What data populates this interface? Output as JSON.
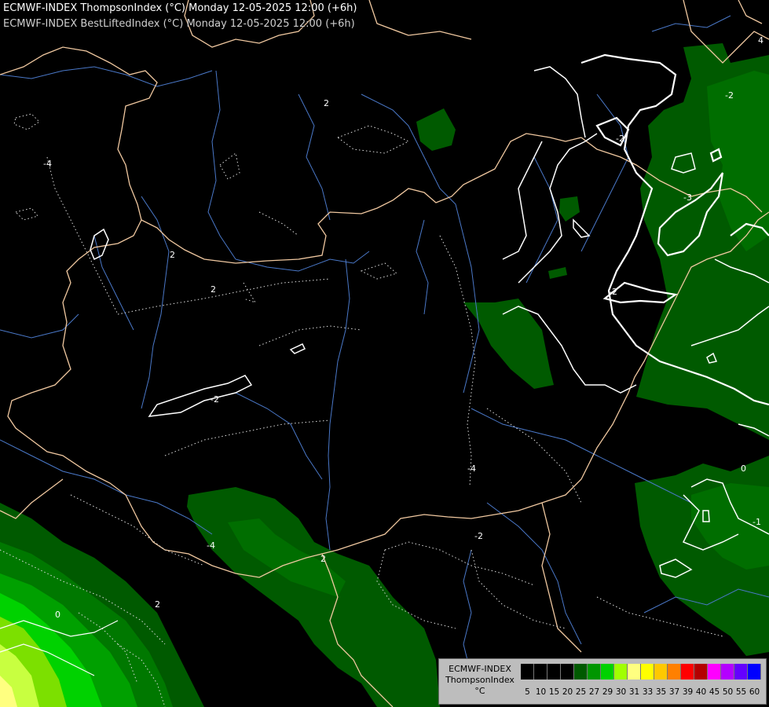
{
  "header": {
    "line1": "ECMWF-INDEX ThompsonIndex (°C) Monday 12-05-2025 12:00 (+6h)",
    "line2": "ECMWF-INDEX BestLiftedIndex (°C) Monday 12-05-2025 12:00 (+6h)"
  },
  "legend": {
    "line1": "ECMWF-INDEX",
    "line2": "ThompsonIndex",
    "line3": "°C",
    "bins": [
      {
        "label": "5",
        "color": "#000000"
      },
      {
        "label": "10",
        "color": "#000000"
      },
      {
        "label": "15",
        "color": "#000000"
      },
      {
        "label": "20",
        "color": "#000000"
      },
      {
        "label": "25",
        "color": "#005a00"
      },
      {
        "label": "27",
        "color": "#009600"
      },
      {
        "label": "29",
        "color": "#00d200"
      },
      {
        "label": "30",
        "color": "#a0ff00"
      },
      {
        "label": "31",
        "color": "#ffff80"
      },
      {
        "label": "33",
        "color": "#ffff00"
      },
      {
        "label": "35",
        "color": "#ffc800"
      },
      {
        "label": "37",
        "color": "#ff8000"
      },
      {
        "label": "39",
        "color": "#ff0000"
      },
      {
        "label": "40",
        "color": "#b40000"
      },
      {
        "label": "45",
        "color": "#ff00ff"
      },
      {
        "label": "50",
        "color": "#b400ff"
      },
      {
        "label": "55",
        "color": "#6400ff"
      },
      {
        "label": "60",
        "color": "#0000ff"
      }
    ]
  },
  "contour_labels": [
    "-2",
    "-2",
    "-3",
    "-2",
    "0",
    "-1",
    "2",
    "2",
    "2",
    "-4",
    "-2",
    "-4",
    "-4",
    "-2",
    "4",
    "0",
    "2",
    "2"
  ],
  "colors": {
    "border": "#f0c8a0",
    "river": "#4a78c8",
    "contour": "#ffffff"
  }
}
